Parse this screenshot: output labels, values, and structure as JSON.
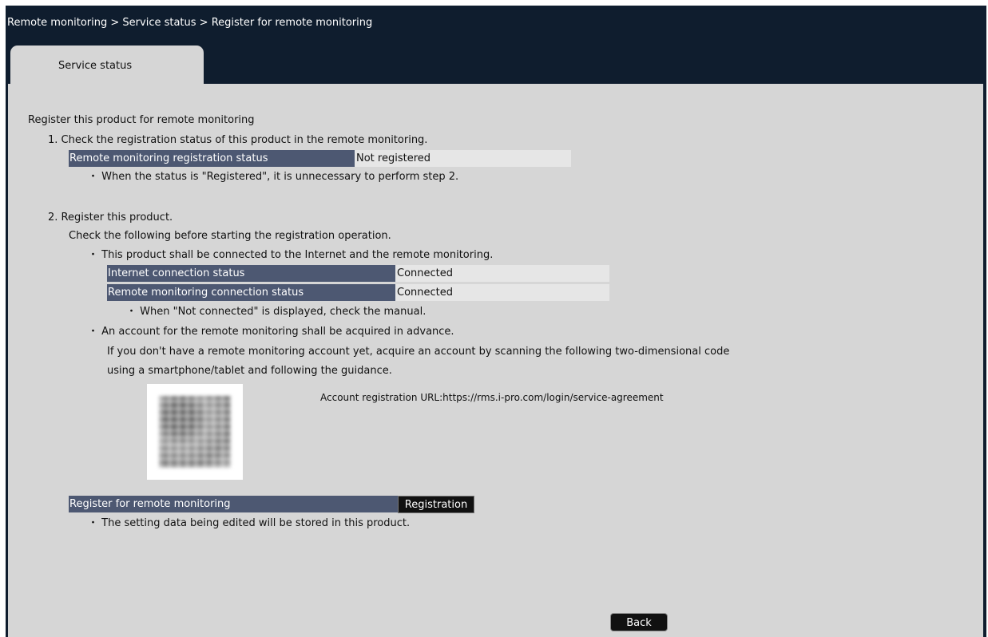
{
  "header": {
    "breadcrumb": "Remote monitoring > Service status > Register for remote monitoring"
  },
  "tabs": [
    {
      "label": "Service status",
      "active": true
    }
  ],
  "main": {
    "heading": "Register this product for remote monitoring",
    "step1": {
      "title": "1. Check the registration status of this product in the remote monitoring.",
      "status_label": "Remote monitoring registration status",
      "status_value": "Not registered",
      "note": "・ When the status is \"Registered\", it is unnecessary to perform step 2."
    },
    "step2": {
      "title": "2. Register this product.",
      "intro": "Check the following before starting the registration operation.",
      "bullet_connection": "・ This product shall be connected to the Internet and the remote monitoring.",
      "internet_label": "Internet connection status",
      "internet_value": "Connected",
      "remote_label": "Remote monitoring connection status",
      "remote_value": "Connected",
      "connection_note": "・ When \"Not connected\" is displayed, check the manual.",
      "bullet_account": "・ An account for the remote monitoring shall be acquired in advance.",
      "account_text_1": "If you don't have a remote monitoring account yet, acquire an account by scanning the following two-dimensional code",
      "account_text_2": "using a smartphone/tablet and following the guidance.",
      "account_url": "Account registration URL:https://rms.i-pro.com/login/service-agreement",
      "register_label": "Register for remote monitoring",
      "register_button": "Registration",
      "register_note": "・ The setting data being edited will be stored in this product."
    },
    "back_button": "Back"
  },
  "colors": {
    "frame": "#0f1d2e",
    "panel": "#d6d6d6",
    "label_bg": "#4d5872",
    "value_bg": "#e6e6e6",
    "button_bg": "#111111"
  }
}
